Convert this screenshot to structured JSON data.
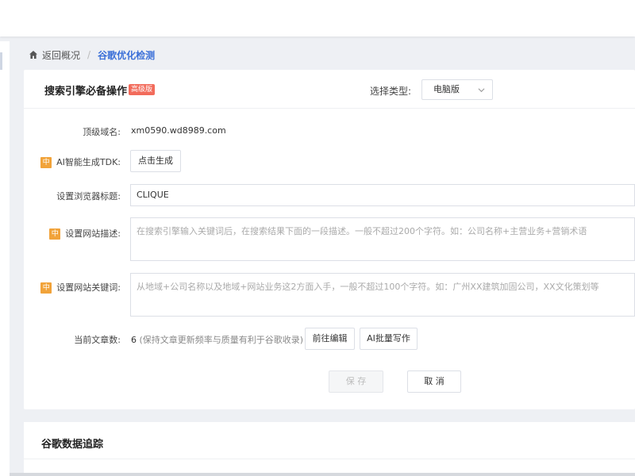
{
  "breadcrumb": {
    "back_label": "返回概况",
    "separator": "/",
    "current_label": "谷歌优化检测"
  },
  "seo_panel": {
    "title": "搜索引擎必备操作",
    "badge": "高级版",
    "type_label": "选择类型:",
    "type_selected": "电脑版",
    "fields": {
      "domain_label": "顶级域名:",
      "domain_value": "xm0590.wd8989.com",
      "tdk_badge": "中",
      "tdk_label": "AI智能生成TDK:",
      "tdk_button": "点击生成",
      "title_label": "设置浏览器标题:",
      "title_value": "CLIQUE",
      "desc_badge": "中",
      "desc_label": "设置网站描述:",
      "desc_placeholder": "在搜索引擎输入关键词后，在搜索结果下面的一段描述。一般不超过200个字符。如：公司名称+主营业务+营销术语",
      "keywords_badge": "中",
      "keywords_label": "设置网站关键词:",
      "keywords_placeholder": "从地域+公司名称以及地域+网站业务这2方面入手，一般不超过100个字符。如：广州XX建筑加固公司，XX文化策划等",
      "article_label": "当前文章数:",
      "article_count": "6",
      "article_hint": "(保持文章更新频率与质量有利于谷歌收录)",
      "edit_button": "前往编辑",
      "ai_write_button": "AI批量写作"
    },
    "save_button": "保 存",
    "cancel_button": "取 消"
  },
  "tracking_panel": {
    "title": "谷歌数据追踪"
  },
  "colors": {
    "accent": "#3a6fd8",
    "badge_red": "#f26b5b",
    "badge_orange": "#f1a33a",
    "background": "#eef0f4"
  }
}
